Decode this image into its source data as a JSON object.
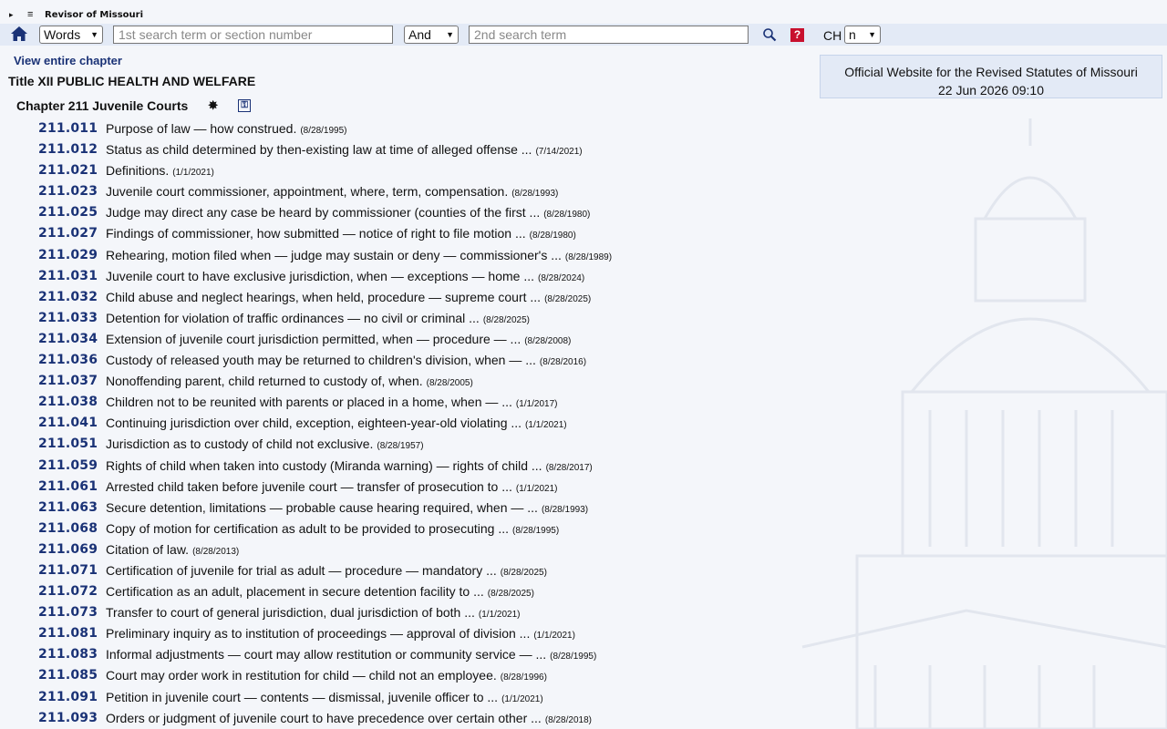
{
  "topbar": {
    "expand_glyph": "▸",
    "menu_glyph": "≡",
    "brand": "Revisor of Missouri"
  },
  "search": {
    "mode_value": "Words",
    "term1_placeholder": "1st search term or section number",
    "operator_value": "And",
    "term2_placeholder": "2nd search term",
    "ch_label": "CH",
    "ch_value": "n",
    "help_glyph": "?"
  },
  "nav": {
    "view_chapter": "View entire chapter"
  },
  "title": "Title XII PUBLIC HEALTH AND WELFARE",
  "chapter": {
    "name": "Chapter 211 Juvenile Courts",
    "star_glyph": "✸",
    "key_glyph": "⚿"
  },
  "info": {
    "line1": "Official Website for the Revised Statutes of Missouri",
    "line2": "22 Jun 2026 09:10"
  },
  "sections": [
    {
      "number": "211.011",
      "desc": "Purpose of law — how construed.",
      "date": "(8/28/1995)"
    },
    {
      "number": "211.012",
      "desc": "Status as child determined by then-existing law at time of alleged offense ...",
      "date": "(7/14/2021)"
    },
    {
      "number": "211.021",
      "desc": "Definitions.",
      "date": "(1/1/2021)"
    },
    {
      "number": "211.023",
      "desc": "Juvenile court commissioner, appointment, where, term, compensation.",
      "date": "(8/28/1993)"
    },
    {
      "number": "211.025",
      "desc": "Judge may direct any case be heard by commissioner (counties of the first ...",
      "date": "(8/28/1980)"
    },
    {
      "number": "211.027",
      "desc": "Findings of commissioner, how submitted — notice of right to file motion ...",
      "date": "(8/28/1980)"
    },
    {
      "number": "211.029",
      "desc": "Rehearing, motion filed when — judge may sustain or deny — commissioner's ...",
      "date": "(8/28/1989)"
    },
    {
      "number": "211.031",
      "desc": "Juvenile court to have exclusive jurisdiction, when — exceptions — home ...",
      "date": "(8/28/2024)"
    },
    {
      "number": "211.032",
      "desc": "Child abuse and neglect hearings, when held, procedure — supreme court ...",
      "date": "(8/28/2025)"
    },
    {
      "number": "211.033",
      "desc": "Detention for violation of traffic ordinances — no civil or criminal ...",
      "date": "(8/28/2025)"
    },
    {
      "number": "211.034",
      "desc": "Extension of juvenile court jurisdiction permitted, when — procedure — ...",
      "date": "(8/28/2008)"
    },
    {
      "number": "211.036",
      "desc": "Custody of released youth may be returned to children's division, when — ...",
      "date": "(8/28/2016)"
    },
    {
      "number": "211.037",
      "desc": "Nonoffending parent, child returned to custody of, when.",
      "date": "(8/28/2005)"
    },
    {
      "number": "211.038",
      "desc": "Children not to be reunited with parents or placed in a home, when — ...",
      "date": "(1/1/2017)"
    },
    {
      "number": "211.041",
      "desc": "Continuing jurisdiction over child, exception, eighteen-year-old violating ...",
      "date": "(1/1/2021)"
    },
    {
      "number": "211.051",
      "desc": "Jurisdiction as to custody of child not exclusive.",
      "date": "(8/28/1957)"
    },
    {
      "number": "211.059",
      "desc": "Rights of child when taken into custody (Miranda warning) — rights of child ...",
      "date": "(8/28/2017)"
    },
    {
      "number": "211.061",
      "desc": "Arrested child taken before juvenile court — transfer of prosecution to ...",
      "date": "(1/1/2021)"
    },
    {
      "number": "211.063",
      "desc": "Secure detention, limitations — probable cause hearing required, when — ...",
      "date": "(8/28/1993)"
    },
    {
      "number": "211.068",
      "desc": "Copy of motion for certification as adult to be provided to prosecuting ...",
      "date": "(8/28/1995)"
    },
    {
      "number": "211.069",
      "desc": "Citation of law.",
      "date": "(8/28/2013)"
    },
    {
      "number": "211.071",
      "desc": "Certification of juvenile for trial as adult — procedure — mandatory ...",
      "date": "(8/28/2025)"
    },
    {
      "number": "211.072",
      "desc": "Certification as an adult, placement in secure detention facility to ...",
      "date": "(8/28/2025)"
    },
    {
      "number": "211.073",
      "desc": "Transfer to court of general jurisdiction, dual jurisdiction of both ...",
      "date": "(1/1/2021)"
    },
    {
      "number": "211.081",
      "desc": "Preliminary inquiry as to institution of proceedings — approval of division ...",
      "date": "(1/1/2021)"
    },
    {
      "number": "211.083",
      "desc": "Informal adjustments — court may allow restitution or community service — ...",
      "date": "(8/28/1995)"
    },
    {
      "number": "211.085",
      "desc": "Court may order work in restitution for child — child not an employee.",
      "date": "(8/28/1996)"
    },
    {
      "number": "211.091",
      "desc": "Petition in juvenile court — contents — dismissal, juvenile officer to ...",
      "date": "(1/1/2021)"
    },
    {
      "number": "211.093",
      "desc": "Orders or judgment of juvenile court to have precedence over certain other ...",
      "date": "(8/28/2018)"
    }
  ]
}
